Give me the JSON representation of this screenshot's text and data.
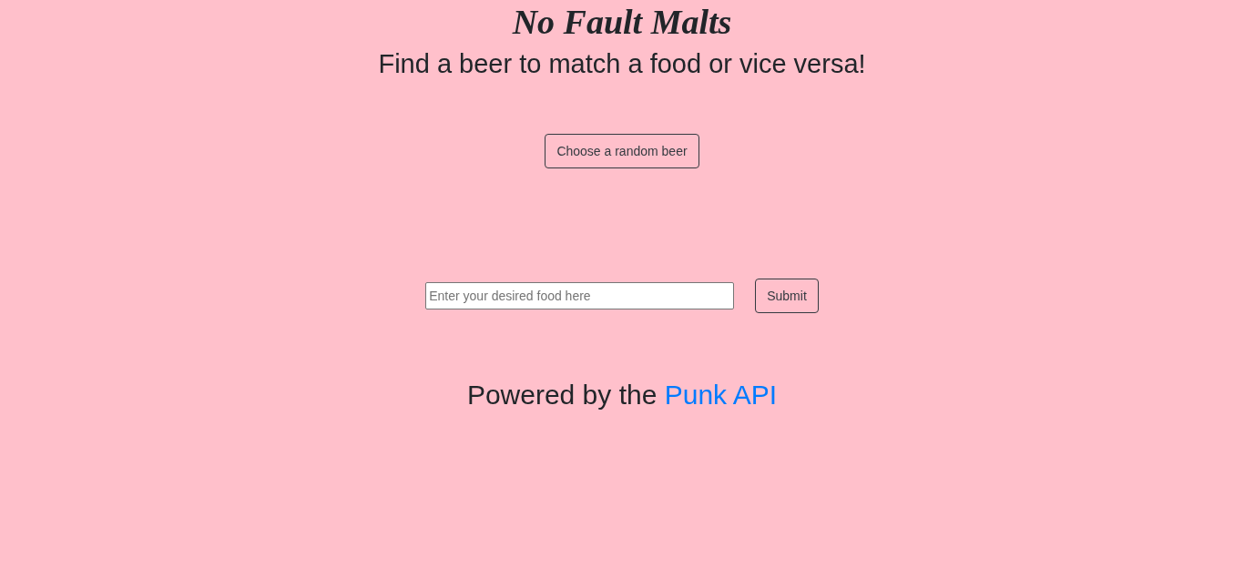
{
  "header": {
    "title": "No Fault Malts",
    "tagline": "Find a beer to match a food or vice versa!"
  },
  "random_button": {
    "label": "Choose a random beer"
  },
  "food_search": {
    "placeholder": "Enter your desired food here",
    "button": "Submit"
  },
  "footer": {
    "text": "Powered by the",
    "link": "Punk API"
  }
}
